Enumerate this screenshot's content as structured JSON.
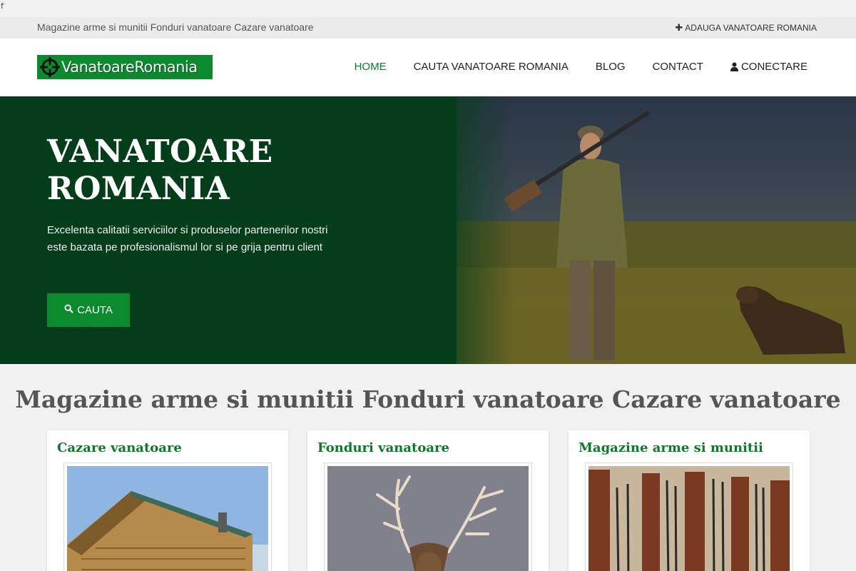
{
  "stray_text": "f",
  "topbar": {
    "tagline": "Magazine arme si munitii Fonduri vanatoare Cazare vanatoare",
    "add_link": "ADAUGA VANATOARE ROMANIA"
  },
  "header": {
    "logo_text": "VanatoareRomania",
    "nav": [
      {
        "label": "HOME",
        "active": true
      },
      {
        "label": "CAUTA VANATOARE ROMANIA"
      },
      {
        "label": "BLOG"
      },
      {
        "label": "CONTACT"
      },
      {
        "label": "CONECTARE",
        "icon": "user-icon"
      }
    ]
  },
  "hero": {
    "title": "VANATOARE ROMANIA",
    "description": "Excelenta calitatii serviciilor si produselor partenerilor nostri este bazata pe profesionalismul lor si pe grija pentru client",
    "button_label": "CAUTA",
    "button_icon": "search-icon"
  },
  "main": {
    "section_title": "Magazine arme si munitii Fonduri vanatoare Cazare vanatoare",
    "cards": [
      {
        "title": "Cazare vanatoare",
        "image": "log-cabin-image"
      },
      {
        "title": "Fonduri vanatoare",
        "image": "deer-image"
      },
      {
        "title": "Magazine arme si munitii",
        "image": "gun-rack-image"
      }
    ]
  },
  "colors": {
    "brand_green": "#0b8a2e",
    "hero_bg": "#043d1a",
    "nav_active": "#0b7a2a"
  }
}
